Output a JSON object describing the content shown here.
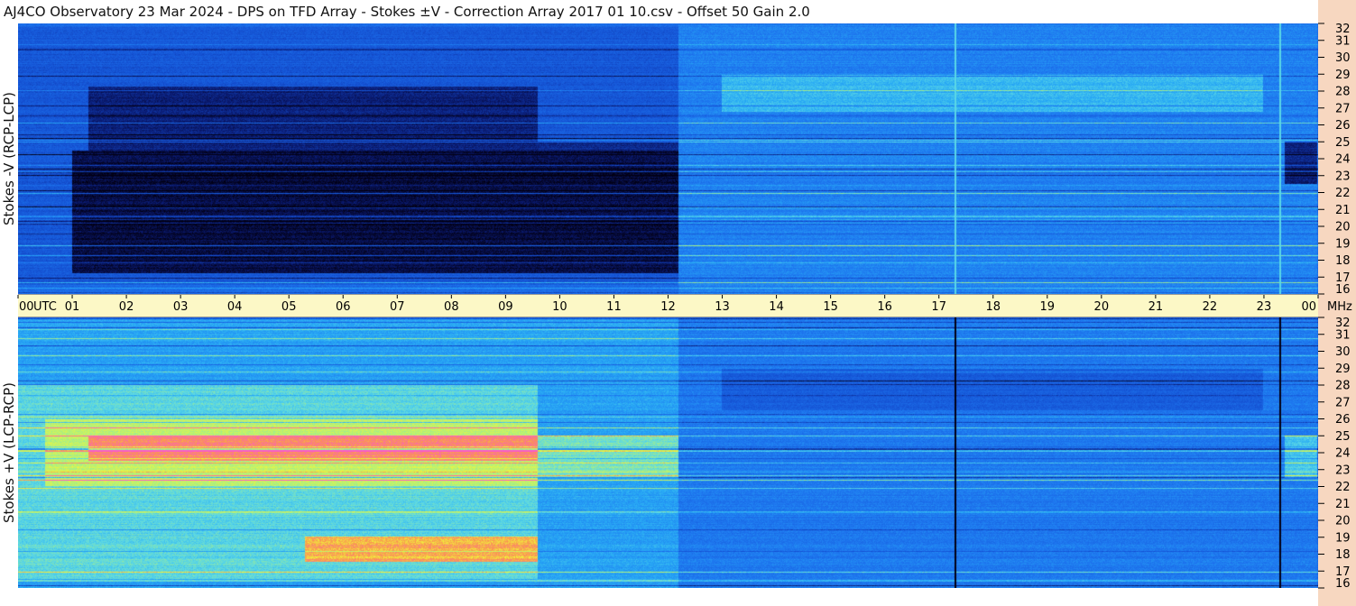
{
  "title": "AJ4CO Observatory  23 Mar 2024  -  DPS on TFD Array  -  Stokes ±V  -  Correction Array 2017 01 10.csv  -  Offset 50  Gain 2.0",
  "chart_data": [
    {
      "type": "heatmap",
      "panel": "top",
      "ylabel": "Stokes -V  (RCP-LCP)",
      "ylim": [
        16,
        32
      ],
      "yticks": [
        "16",
        "17",
        "18",
        "19",
        "20",
        "21",
        "22",
        "23",
        "24",
        "25",
        "26",
        "27",
        "28",
        "29",
        "30",
        "31",
        "32"
      ],
      "xlabel": "UTC",
      "xlim": [
        0,
        24
      ],
      "xticks": [
        "00",
        "01",
        "02",
        "03",
        "04",
        "05",
        "06",
        "07",
        "08",
        "09",
        "10",
        "11",
        "12",
        "13",
        "14",
        "15",
        "16",
        "17",
        "18",
        "19",
        "20",
        "21",
        "22",
        "23",
        "00"
      ],
      "regions": [
        {
          "t0": 0.0,
          "t1": 12.2,
          "f0": 16.5,
          "f1": 31.8,
          "level": 0.28
        },
        {
          "t0": 1.0,
          "t1": 12.2,
          "f0": 17.2,
          "f1": 24.5,
          "level": 0.05
        },
        {
          "t0": 1.3,
          "t1": 9.6,
          "f0": 24.5,
          "f1": 28.3,
          "level": 0.12
        },
        {
          "t0": 9.6,
          "t1": 12.2,
          "f0": 24.5,
          "f1": 25.0,
          "level": 0.14
        },
        {
          "t0": 12.2,
          "t1": 24.0,
          "f0": 16.0,
          "f1": 32.0,
          "level": 0.42
        },
        {
          "t0": 13.0,
          "t1": 23.0,
          "f0": 26.8,
          "f1": 29.0,
          "level": 0.55
        },
        {
          "t0": 23.4,
          "t1": 24.0,
          "f0": 22.5,
          "f1": 25.0,
          "level": 0.12
        }
      ],
      "vlines": [
        {
          "t": 17.3,
          "level": 0.62
        },
        {
          "t": 23.3,
          "level": 0.62
        }
      ]
    },
    {
      "type": "heatmap",
      "panel": "bottom",
      "ylabel": "Stokes +V  (LCP-RCP)",
      "ylim": [
        16,
        32
      ],
      "yticks": [
        "16",
        "17",
        "18",
        "19",
        "20",
        "21",
        "22",
        "23",
        "24",
        "25",
        "26",
        "27",
        "28",
        "29",
        "30",
        "31",
        "32"
      ],
      "xlabel": "UTC",
      "xlim": [
        0,
        24
      ],
      "xticks": [
        "00",
        "01",
        "02",
        "03",
        "04",
        "05",
        "06",
        "07",
        "08",
        "09",
        "10",
        "11",
        "12",
        "13",
        "14",
        "15",
        "16",
        "17",
        "18",
        "19",
        "20",
        "21",
        "22",
        "23",
        "00"
      ],
      "regions": [
        {
          "t0": 0.0,
          "t1": 12.2,
          "f0": 16.0,
          "f1": 32.0,
          "level": 0.5
        },
        {
          "t0": 0.0,
          "t1": 9.6,
          "f0": 16.5,
          "f1": 28.0,
          "level": 0.62
        },
        {
          "t0": 0.5,
          "t1": 9.6,
          "f0": 22.0,
          "f1": 26.0,
          "level": 0.75
        },
        {
          "t0": 1.3,
          "t1": 9.6,
          "f0": 23.5,
          "f1": 25.0,
          "level": 0.93
        },
        {
          "t0": 5.3,
          "t1": 9.6,
          "f0": 17.5,
          "f1": 19.0,
          "level": 0.88
        },
        {
          "t0": 9.6,
          "t1": 12.2,
          "f0": 22.5,
          "f1": 25.0,
          "level": 0.66
        },
        {
          "t0": 12.2,
          "t1": 24.0,
          "f0": 16.0,
          "f1": 32.0,
          "level": 0.4
        },
        {
          "t0": 13.0,
          "t1": 23.0,
          "f0": 26.5,
          "f1": 29.0,
          "level": 0.3
        },
        {
          "t0": 23.4,
          "t1": 24.0,
          "f0": 22.5,
          "f1": 25.0,
          "level": 0.58
        }
      ],
      "vlines": [
        {
          "t": 17.3,
          "level": 0.0
        },
        {
          "t": 23.3,
          "level": 0.0
        }
      ]
    }
  ],
  "time_axis": {
    "utc_label": "UTC",
    "mhz_label": "MHz",
    "ticks": [
      "00",
      "01",
      "02",
      "03",
      "04",
      "05",
      "06",
      "07",
      "08",
      "09",
      "10",
      "11",
      "12",
      "13",
      "14",
      "15",
      "16",
      "17",
      "18",
      "19",
      "20",
      "21",
      "22",
      "23",
      "00"
    ]
  }
}
